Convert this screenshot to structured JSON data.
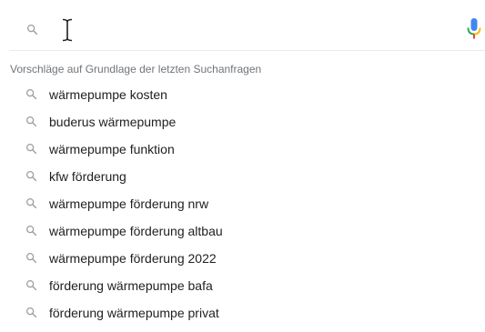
{
  "search": {
    "value": "",
    "placeholder": ""
  },
  "icons": {
    "search": "search-icon",
    "cursor": "text-cursor-icon",
    "mic": "microphone-icon"
  },
  "colors": {
    "icon_gray": "#9aa0a6",
    "text": "#202124",
    "muted": "#70757a",
    "mic_blue": "#4285f4",
    "mic_red": "#ea4335",
    "mic_yellow": "#fbbc04",
    "mic_green": "#34a853"
  },
  "suggestions": {
    "header": "Vorschläge auf Grundlage der letzten Suchanfragen",
    "items": [
      {
        "label": "wärmepumpe kosten"
      },
      {
        "label": "buderus wärmepumpe"
      },
      {
        "label": "wärmepumpe funktion"
      },
      {
        "label": "kfw förderung"
      },
      {
        "label": "wärmepumpe förderung nrw"
      },
      {
        "label": "wärmepumpe förderung altbau"
      },
      {
        "label": "wärmepumpe förderung 2022"
      },
      {
        "label": "förderung wärmepumpe bafa"
      },
      {
        "label": "förderung wärmepumpe privat"
      }
    ]
  }
}
